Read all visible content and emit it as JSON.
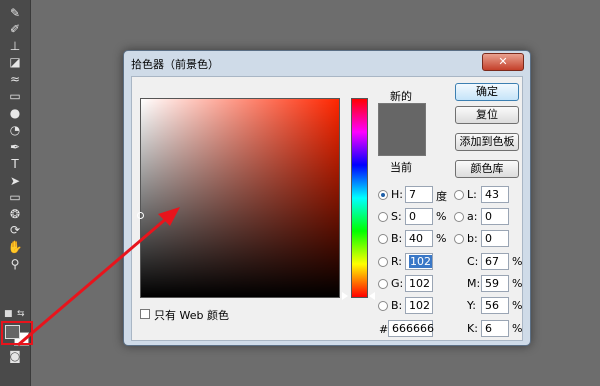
{
  "toolbox": {
    "tools": [
      {
        "name": "history-brush-icon",
        "glyph": "✎"
      },
      {
        "name": "brush-icon",
        "glyph": "✐"
      },
      {
        "name": "stamp-icon",
        "glyph": "⊥"
      },
      {
        "name": "eraser-icon",
        "glyph": "◪"
      },
      {
        "name": "smudge-icon",
        "glyph": "≈"
      },
      {
        "name": "gradient-icon",
        "glyph": "▭"
      },
      {
        "name": "blur-icon",
        "glyph": "●"
      },
      {
        "name": "dodge-icon",
        "glyph": "◔"
      },
      {
        "name": "pen-icon",
        "glyph": "✒"
      },
      {
        "name": "type-icon",
        "glyph": "T"
      },
      {
        "name": "path-select-icon",
        "glyph": "➤"
      },
      {
        "name": "shape-icon",
        "glyph": "▭"
      },
      {
        "name": "3d-rotate-icon",
        "glyph": "❂"
      },
      {
        "name": "3d-orbit-icon",
        "glyph": "⟳"
      },
      {
        "name": "hand-icon",
        "glyph": "✋"
      },
      {
        "name": "zoom-icon",
        "glyph": "⚲"
      }
    ],
    "quick_mask_glyph": "◙"
  },
  "dialog": {
    "title": "拾色器（前景色）",
    "close_label": "✕",
    "new_label": "新的",
    "current_label": "当前",
    "web_only_label": "只有 Web 颜色",
    "buttons": {
      "ok": "确定",
      "reset": "复位",
      "add_swatch": "添加到色板",
      "libraries": "颜色库"
    },
    "hsb": {
      "h": {
        "label": "H:",
        "value": "7",
        "unit": "度"
      },
      "s": {
        "label": "S:",
        "value": "0",
        "unit": "%"
      },
      "b": {
        "label": "B:",
        "value": "40",
        "unit": "%"
      }
    },
    "rgb": {
      "r": {
        "label": "R:",
        "value": "102"
      },
      "g": {
        "label": "G:",
        "value": "102"
      },
      "b": {
        "label": "B:",
        "value": "102"
      }
    },
    "lab": {
      "l": {
        "label": "L:",
        "value": "43"
      },
      "a": {
        "label": "a:",
        "value": "0"
      },
      "b": {
        "label": "b:",
        "value": "0"
      }
    },
    "cmyk": {
      "c": {
        "label": "C:",
        "value": "67",
        "unit": "%"
      },
      "m": {
        "label": "M:",
        "value": "59",
        "unit": "%"
      },
      "y": {
        "label": "Y:",
        "value": "56",
        "unit": "%"
      },
      "k": {
        "label": "K:",
        "value": "6",
        "unit": "%"
      }
    },
    "hex": {
      "label": "#",
      "value": "666666"
    }
  },
  "colors": {
    "current_color": "#666666",
    "new_color": "#666666",
    "annotation": "#e8141c"
  }
}
